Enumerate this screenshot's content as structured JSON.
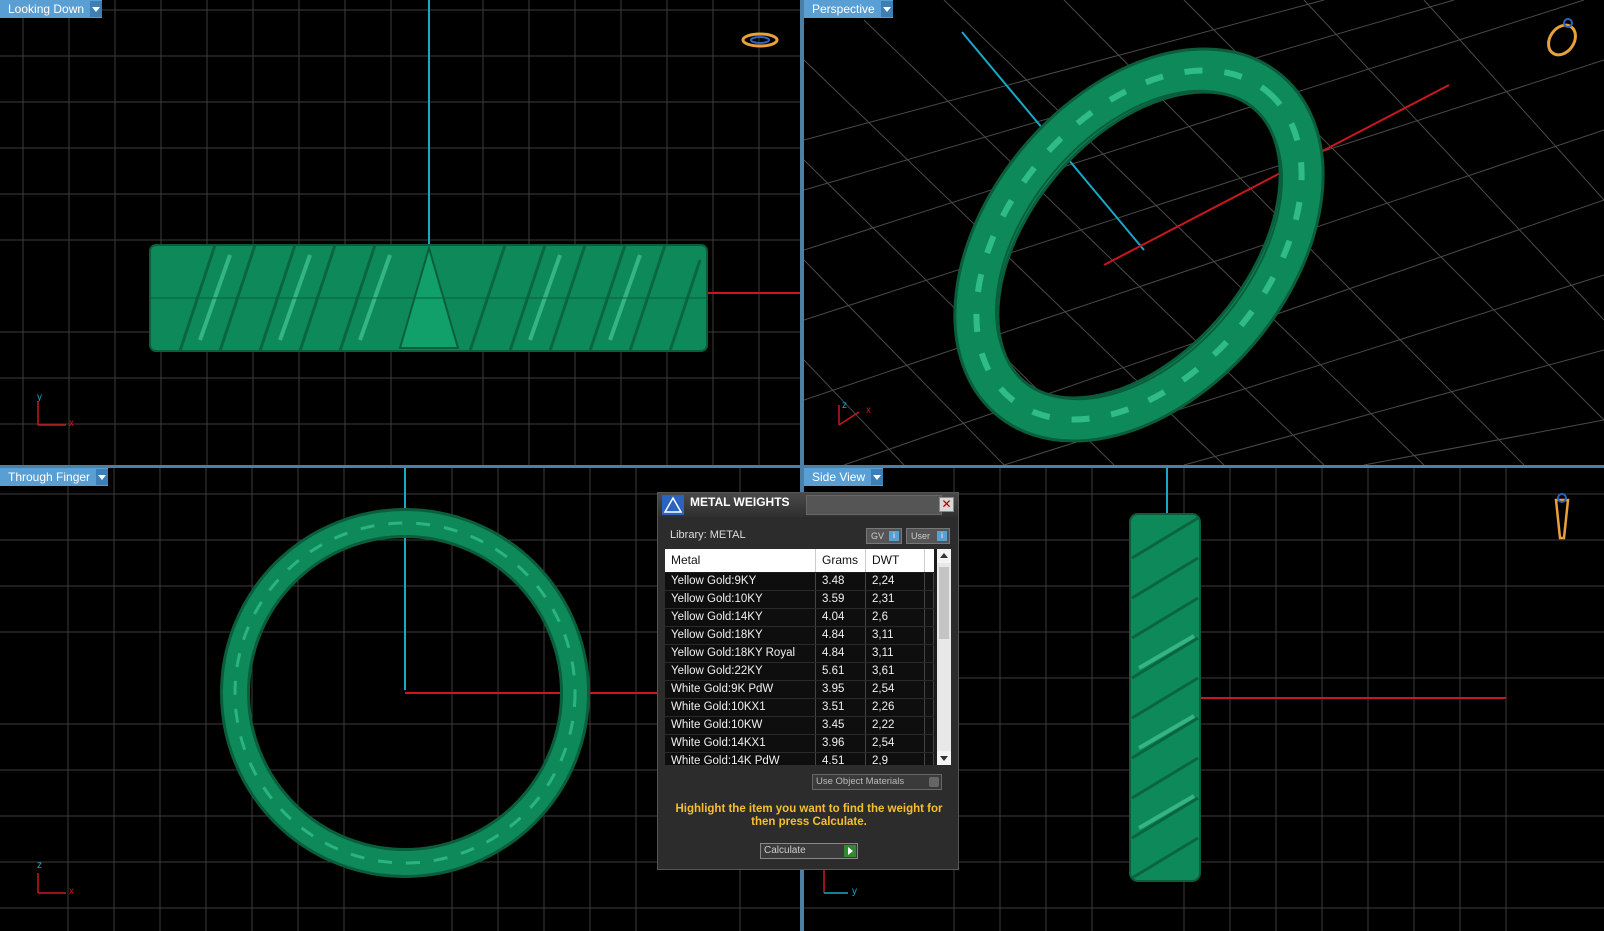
{
  "viewports": {
    "top_left": {
      "label": "Looking Down",
      "axis_a": "y",
      "axis_b": "x"
    },
    "top_right": {
      "label": "Perspective",
      "axis_a": "z",
      "axis_b": "x"
    },
    "bottom_left": {
      "label": "Through Finger",
      "axis_a": "z",
      "axis_b": "x"
    },
    "bottom_right": {
      "label": "Side View",
      "axis_a": "y"
    }
  },
  "colors": {
    "ring": "#0e8a5a",
    "grid": "#3d3d3d",
    "axis_v": "#1aa7c9",
    "axis_h": "#c8181e",
    "accent": "#5a9fd4",
    "hint": "#f5c02b"
  },
  "icons": {
    "nav_ring": "ring-navigator-icon",
    "nav_stand": "ring-stand-icon",
    "close": "close-icon"
  },
  "dialog": {
    "title": "METAL WEIGHTS",
    "library": "Library: METAL",
    "pill_gv": "GV",
    "pill_user": "User",
    "pill_info": "i",
    "headers": {
      "metal": "Metal",
      "grams": "Grams",
      "dwt": "DWT"
    },
    "rows": [
      {
        "metal": "Yellow Gold:9KY",
        "grams": "3.48",
        "dwt": "2,24"
      },
      {
        "metal": "Yellow Gold:10KY",
        "grams": "3.59",
        "dwt": "2,31"
      },
      {
        "metal": "Yellow Gold:14KY",
        "grams": "4.04",
        "dwt": "2,6"
      },
      {
        "metal": "Yellow Gold:18KY",
        "grams": "4.84",
        "dwt": "3,11"
      },
      {
        "metal": "Yellow Gold:18KY Royal",
        "grams": "4.84",
        "dwt": "3,11"
      },
      {
        "metal": "Yellow Gold:22KY",
        "grams": "5.61",
        "dwt": "3,61"
      },
      {
        "metal": "White Gold:9K PdW",
        "grams": "3.95",
        "dwt": "2,54"
      },
      {
        "metal": "White Gold:10KX1",
        "grams": "3.51",
        "dwt": "2,26"
      },
      {
        "metal": "White Gold:10KW",
        "grams": "3.45",
        "dwt": "2,22"
      },
      {
        "metal": "White Gold:14KX1",
        "grams": "3.96",
        "dwt": "2,54"
      },
      {
        "metal": "White Gold:14K PdW",
        "grams": "4.51",
        "dwt": "2,9"
      }
    ],
    "use_object_materials": "Use Object Materials",
    "hint": "Highlight the item you want to find the weight for then press Calculate.",
    "calculate": "Calculate"
  }
}
